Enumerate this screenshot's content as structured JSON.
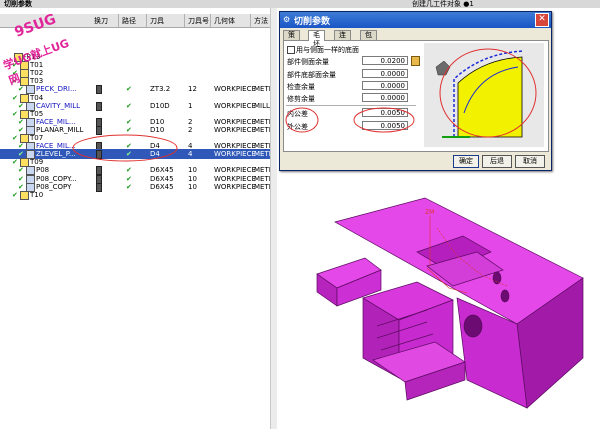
{
  "window": {
    "title_left": "切削参数",
    "title_right": "创建几工件对象 ●1"
  },
  "brand": {
    "line1": "9SUG",
    "line2": "学UG就上UG网"
  },
  "navigator": {
    "columns": [
      "换刀",
      "路径",
      "刀具",
      "刀具号",
      "几何体",
      "方法"
    ],
    "rows": [
      {
        "indent": 0,
        "name": "-R13",
        "tool": "",
        "num": "",
        "geom": "",
        "method": "",
        "check": false,
        "blue": false,
        "sel": false
      },
      {
        "indent": 1,
        "name": "T01",
        "tool": "",
        "num": "",
        "geom": "",
        "method": "",
        "check": true,
        "blue": false,
        "sel": false
      },
      {
        "indent": 1,
        "name": "T02",
        "tool": "",
        "num": "",
        "geom": "",
        "method": "",
        "check": true,
        "blue": false,
        "sel": false
      },
      {
        "indent": 1,
        "name": "T03",
        "tool": "",
        "num": "",
        "geom": "",
        "method": "",
        "check": true,
        "blue": false,
        "sel": false
      },
      {
        "indent": 2,
        "name": "PECK_DRI...",
        "tool": "ZT3.2",
        "num": "12",
        "geom": "WORKPIECE",
        "method": "METHO",
        "check": true,
        "blue": true,
        "sel": false
      },
      {
        "indent": 1,
        "name": "T04",
        "tool": "",
        "num": "",
        "geom": "",
        "method": "",
        "check": true,
        "blue": false,
        "sel": false
      },
      {
        "indent": 2,
        "name": "CAVITY_MILL",
        "tool": "D10D",
        "num": "1",
        "geom": "WORKPIECE",
        "method": "MILL_",
        "check": true,
        "blue": true,
        "sel": false
      },
      {
        "indent": 1,
        "name": "T05",
        "tool": "",
        "num": "",
        "geom": "",
        "method": "",
        "check": true,
        "blue": false,
        "sel": false
      },
      {
        "indent": 2,
        "name": "FACE_MIL...",
        "tool": "D10",
        "num": "2",
        "geom": "WORKPIECE",
        "method": "METHO",
        "check": true,
        "blue": true,
        "sel": false
      },
      {
        "indent": 2,
        "name": "PLANAR_MILL",
        "tool": "D10",
        "num": "2",
        "geom": "WORKPIECE",
        "method": "METHO",
        "check": true,
        "blue": false,
        "sel": false
      },
      {
        "indent": 1,
        "name": "T07",
        "tool": "",
        "num": "",
        "geom": "",
        "method": "",
        "check": true,
        "blue": false,
        "sel": false
      },
      {
        "indent": 2,
        "name": "FACE_MIL...",
        "tool": "D4",
        "num": "4",
        "geom": "WORKPIECE",
        "method": "METHO",
        "check": true,
        "blue": true,
        "sel": false
      },
      {
        "indent": 2,
        "name": "ZLEVEL_P...",
        "tool": "D4",
        "num": "4",
        "geom": "WORKPIECE",
        "method": "METHO",
        "check": true,
        "blue": false,
        "sel": true
      },
      {
        "indent": 1,
        "name": "T09",
        "tool": "",
        "num": "",
        "geom": "",
        "method": "",
        "check": true,
        "blue": false,
        "sel": false
      },
      {
        "indent": 2,
        "name": "P08",
        "tool": "D6X45",
        "num": "10",
        "geom": "WORKPIECE",
        "method": "METHO",
        "check": true,
        "blue": false,
        "sel": false
      },
      {
        "indent": 2,
        "name": "P08_COPY...",
        "tool": "D6X45",
        "num": "10",
        "geom": "WORKPIECE",
        "method": "METHO",
        "check": true,
        "blue": false,
        "sel": false
      },
      {
        "indent": 2,
        "name": "P08_COPY",
        "tool": "D6X45",
        "num": "10",
        "geom": "WORKPIECE",
        "method": "METHO",
        "check": true,
        "blue": false,
        "sel": false
      },
      {
        "indent": 1,
        "name": "T10",
        "tool": "",
        "num": "",
        "geom": "",
        "method": "",
        "check": true,
        "blue": false,
        "sel": false
      }
    ]
  },
  "dialog": {
    "title": "切削参数",
    "tabs": [
      "策略",
      "毛坯",
      "连接",
      "包容"
    ],
    "active_tab": "毛坯",
    "checkbox_label": "用与侧面一样的底面",
    "fields": [
      {
        "label": "部件侧面余量",
        "value": "0.0200",
        "lock": true
      },
      {
        "label": "部件底部面余量",
        "value": "0.0000",
        "lock": false
      },
      {
        "label": "检查余量",
        "value": "0.0000",
        "lock": false
      },
      {
        "label": "修剪余量",
        "value": "0.0000",
        "lock": false
      },
      {
        "label": "内公差",
        "value": "0.0050",
        "lock": false
      },
      {
        "label": "外公差",
        "value": "0.0050",
        "lock": false
      }
    ],
    "buttons": {
      "ok": "确定",
      "back": "后退",
      "cancel": "取消"
    }
  },
  "viewport": {
    "axis_label": "ZM",
    "part_color": "#d21fd9"
  }
}
